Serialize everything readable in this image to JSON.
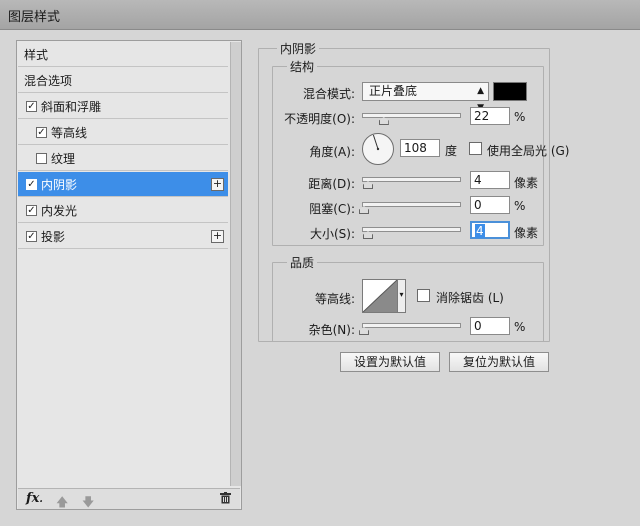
{
  "window": {
    "title": "图层样式"
  },
  "sidebar": {
    "items": [
      {
        "label": "样式",
        "checkbox": false,
        "checked": false,
        "plus": false,
        "selected": false
      },
      {
        "label": "混合选项",
        "checkbox": false,
        "checked": false,
        "plus": false,
        "selected": false
      },
      {
        "label": "斜面和浮雕",
        "checkbox": true,
        "checked": true,
        "plus": false,
        "selected": false
      },
      {
        "label": "等高线",
        "checkbox": true,
        "checked": true,
        "plus": false,
        "selected": false
      },
      {
        "label": "纹理",
        "checkbox": true,
        "checked": false,
        "plus": false,
        "selected": false
      },
      {
        "label": "内阴影",
        "checkbox": true,
        "checked": true,
        "plus": true,
        "selected": true
      },
      {
        "label": "内发光",
        "checkbox": true,
        "checked": true,
        "plus": false,
        "selected": false
      },
      {
        "label": "投影",
        "checkbox": true,
        "checked": true,
        "plus": true,
        "selected": false
      }
    ],
    "footer": {
      "fx": "fx",
      "fx_dot": "."
    }
  },
  "panel": {
    "title": "内阴影",
    "structure": {
      "title": "结构",
      "blend_mode_label": "混合模式:",
      "blend_mode_value": "正片叠底",
      "shadow_color": "#000000",
      "opacity_label": "不透明度(O):",
      "opacity_value": "22",
      "opacity_fraction": 0.22,
      "opacity_unit": "%",
      "angle_label": "角度(A):",
      "angle_value": "108",
      "angle_unit": "度",
      "global_light_label": "使用全局光 (G)",
      "global_light_checked": false,
      "distance_label": "距离(D):",
      "distance_value": "4",
      "distance_unit": "像素",
      "choke_label": "阻塞(C):",
      "choke_value": "0",
      "choke_unit": "%",
      "size_label": "大小(S):",
      "size_value": "4",
      "size_unit": "像素"
    },
    "quality": {
      "title": "品质",
      "contour_label": "等高线:",
      "antialias_label": "消除锯齿 (L)",
      "antialias_checked": false,
      "noise_label": "杂色(N):",
      "noise_value": "0",
      "noise_unit": "%"
    },
    "buttons": {
      "make_default": "设置为默认值",
      "reset_default": "复位为默认值"
    }
  }
}
